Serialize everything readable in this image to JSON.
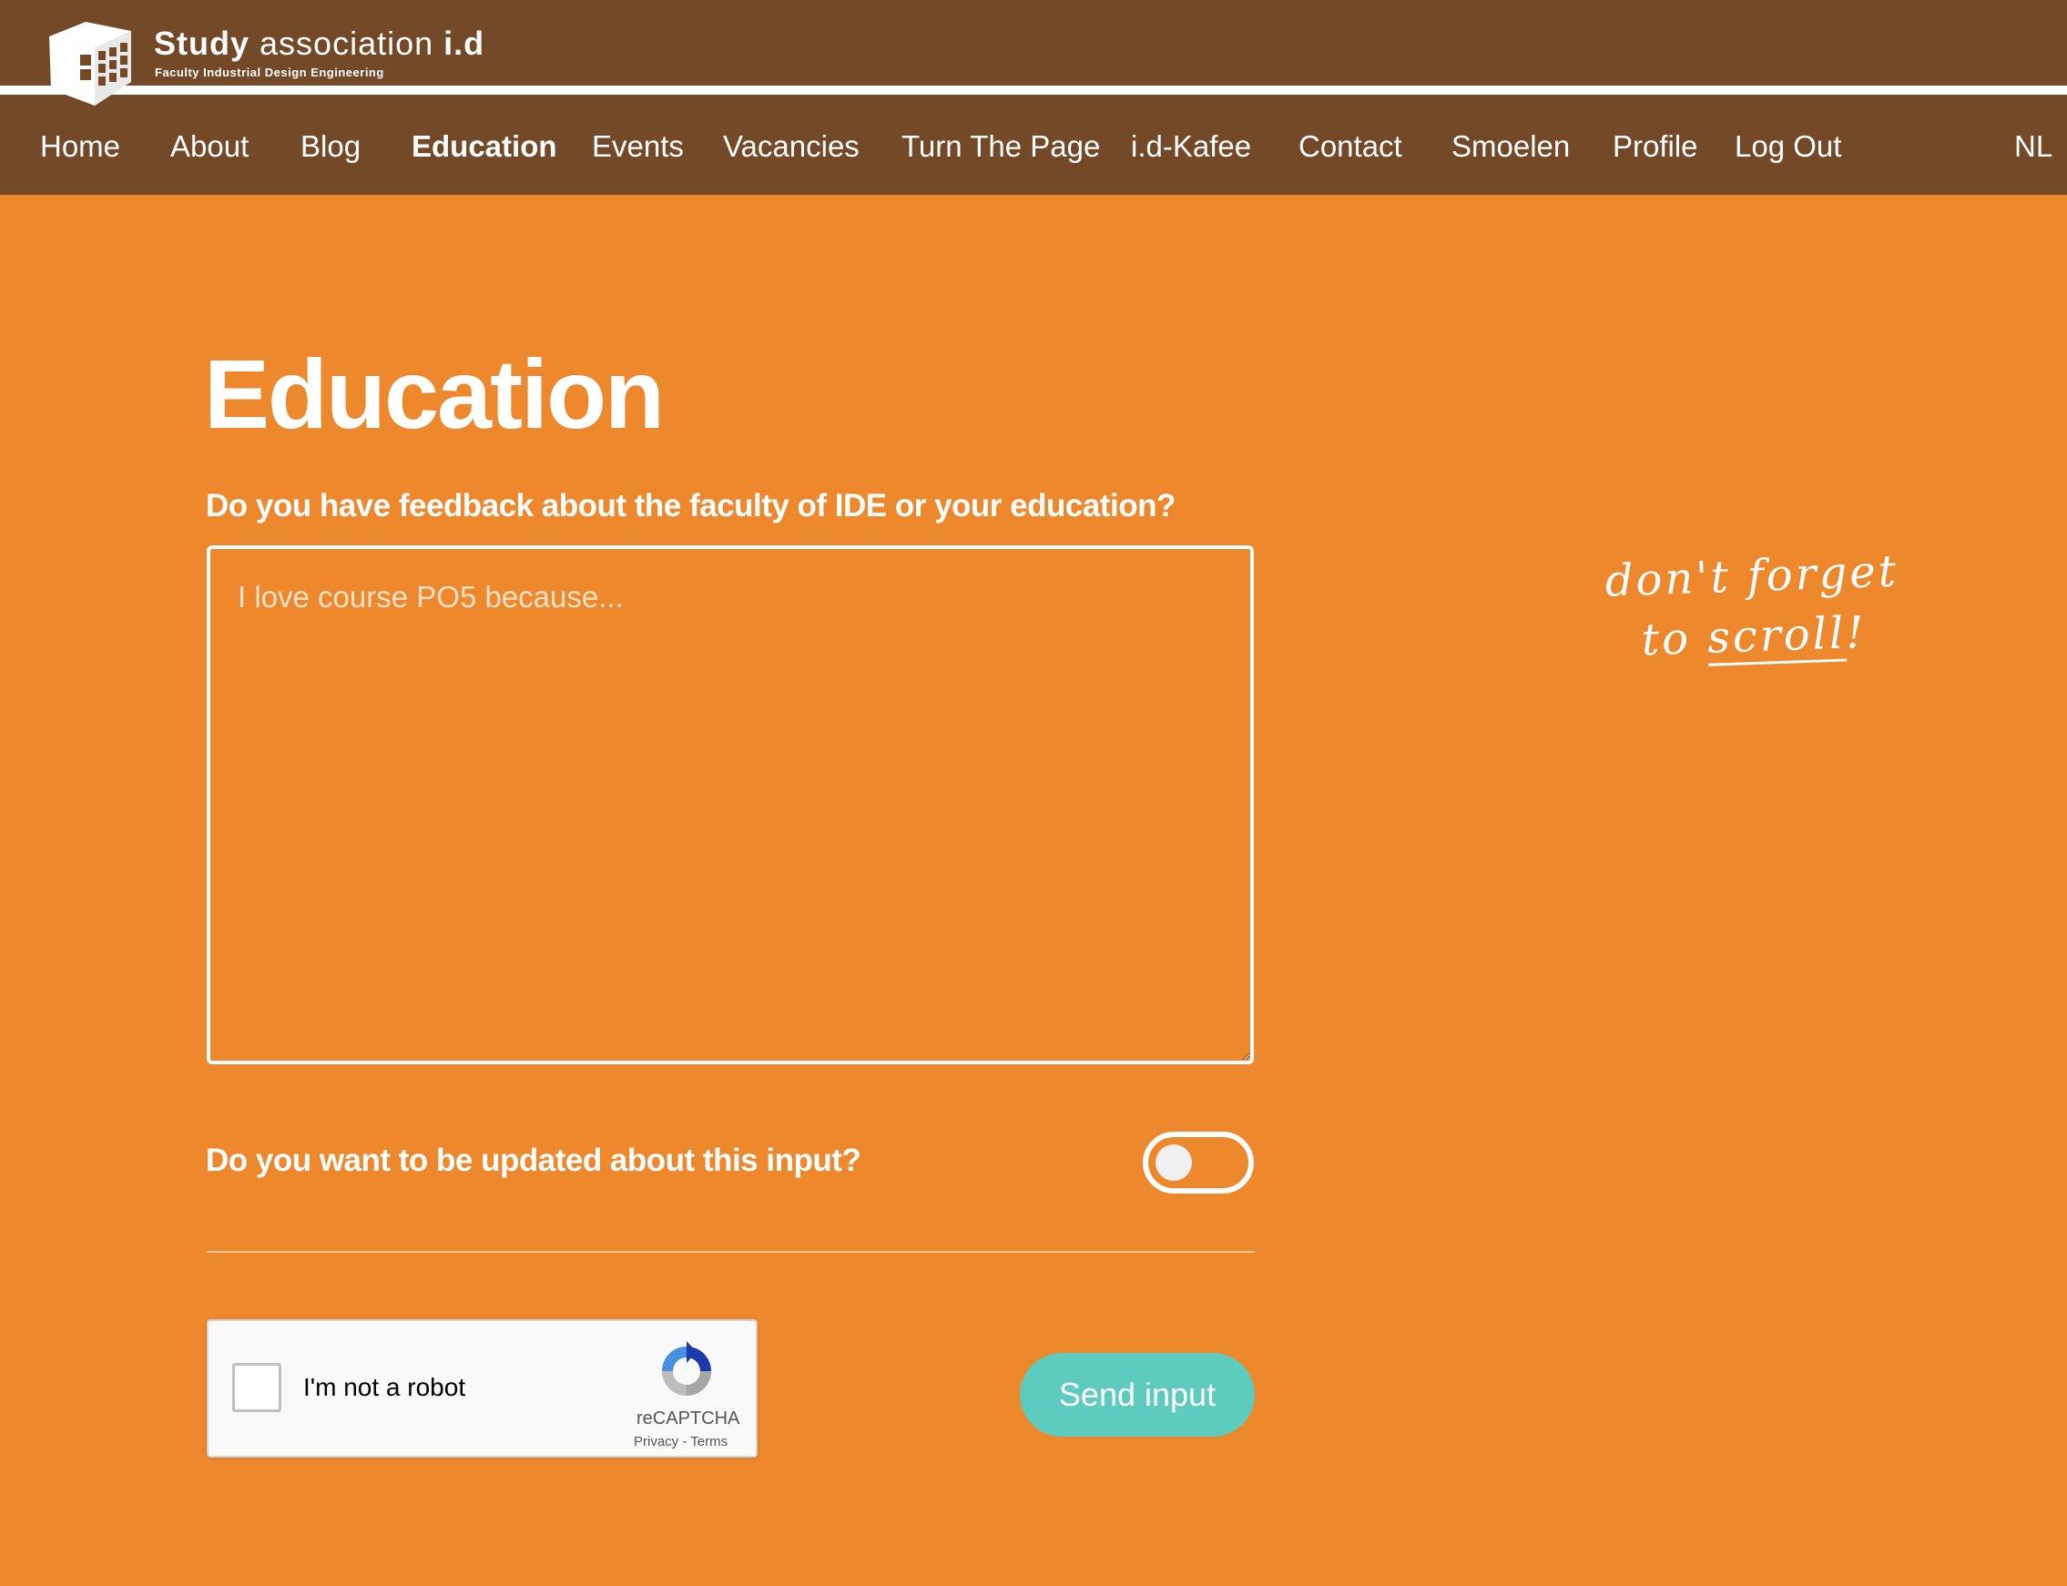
{
  "brand": {
    "title_bold": "Study",
    "title_rest": "association",
    "title_tag": "i.d",
    "subtitle": "Faculty Industrial Design Engineering"
  },
  "nav": {
    "items": [
      {
        "label": "Home"
      },
      {
        "label": "About"
      },
      {
        "label": "Blog"
      },
      {
        "label": "Education",
        "active": true
      },
      {
        "label": "Events"
      },
      {
        "label": "Vacancies"
      },
      {
        "label": "Turn The Page"
      },
      {
        "label": "i.d-Kafee"
      },
      {
        "label": "Contact"
      },
      {
        "label": "Smoelen"
      },
      {
        "label": "Profile"
      },
      {
        "label": "Log Out"
      }
    ],
    "language": "NL"
  },
  "main": {
    "title": "Education",
    "feedback_question": "Do you have feedback about the faculty of IDE or your education?",
    "feedback_value": "",
    "feedback_placeholder": "I love course PO5 because...",
    "update_question": "Do you want to be updated about this input?",
    "update_toggle_on": false,
    "captcha": {
      "label": "I'm not a robot",
      "brand": "reCAPTCHA",
      "links": "Privacy - Terms",
      "checked": false
    },
    "send_label": "Send input"
  },
  "hint": {
    "line1": "don't forget",
    "line2_prefix": "to ",
    "line2_underlined": "scroll",
    "line2_suffix": "!"
  },
  "colors": {
    "header_bg": "#734928",
    "page_bg": "#ee882d",
    "button_bg": "#5dcbbd"
  }
}
